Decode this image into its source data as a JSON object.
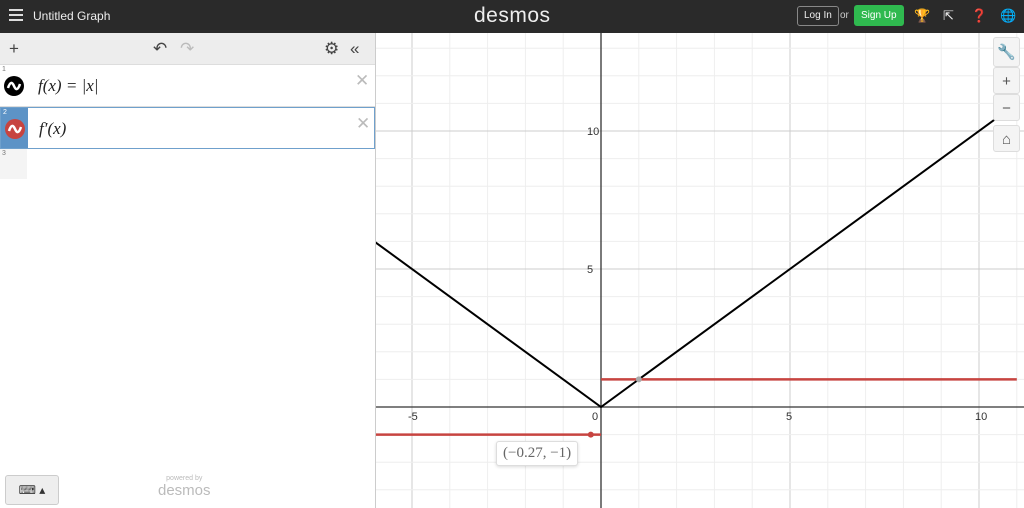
{
  "header": {
    "title": "Untitled Graph",
    "logo": "desmos",
    "login": "Log In",
    "or": "or",
    "signup": "Sign Up"
  },
  "toolbar": {
    "add": "+",
    "undo": "↶",
    "redo": "↷",
    "settings": "⚙",
    "collapse": "«"
  },
  "expressions": [
    {
      "num": "1",
      "latex": "f(x) = |x|",
      "color": "#000000"
    },
    {
      "num": "2",
      "latex": "f′(x)",
      "color": "#c74440"
    },
    {
      "num": "3"
    }
  ],
  "keyboard": "⌨ ▴",
  "powered": {
    "small": "powered by",
    "brand": "desmos"
  },
  "graph_controls": {
    "wrench": "🔧",
    "zoom_in": "+",
    "zoom_out": "−",
    "home": "⌂"
  },
  "axes": {
    "x_ticks": [
      "-5",
      "0",
      "5",
      "10"
    ],
    "y_ticks": [
      "5",
      "10"
    ]
  },
  "tooltip": "(−0.27, −1)",
  "colors": {
    "signup": "#2fb94f",
    "curve1": "#000000",
    "curve2": "#c74440"
  }
}
